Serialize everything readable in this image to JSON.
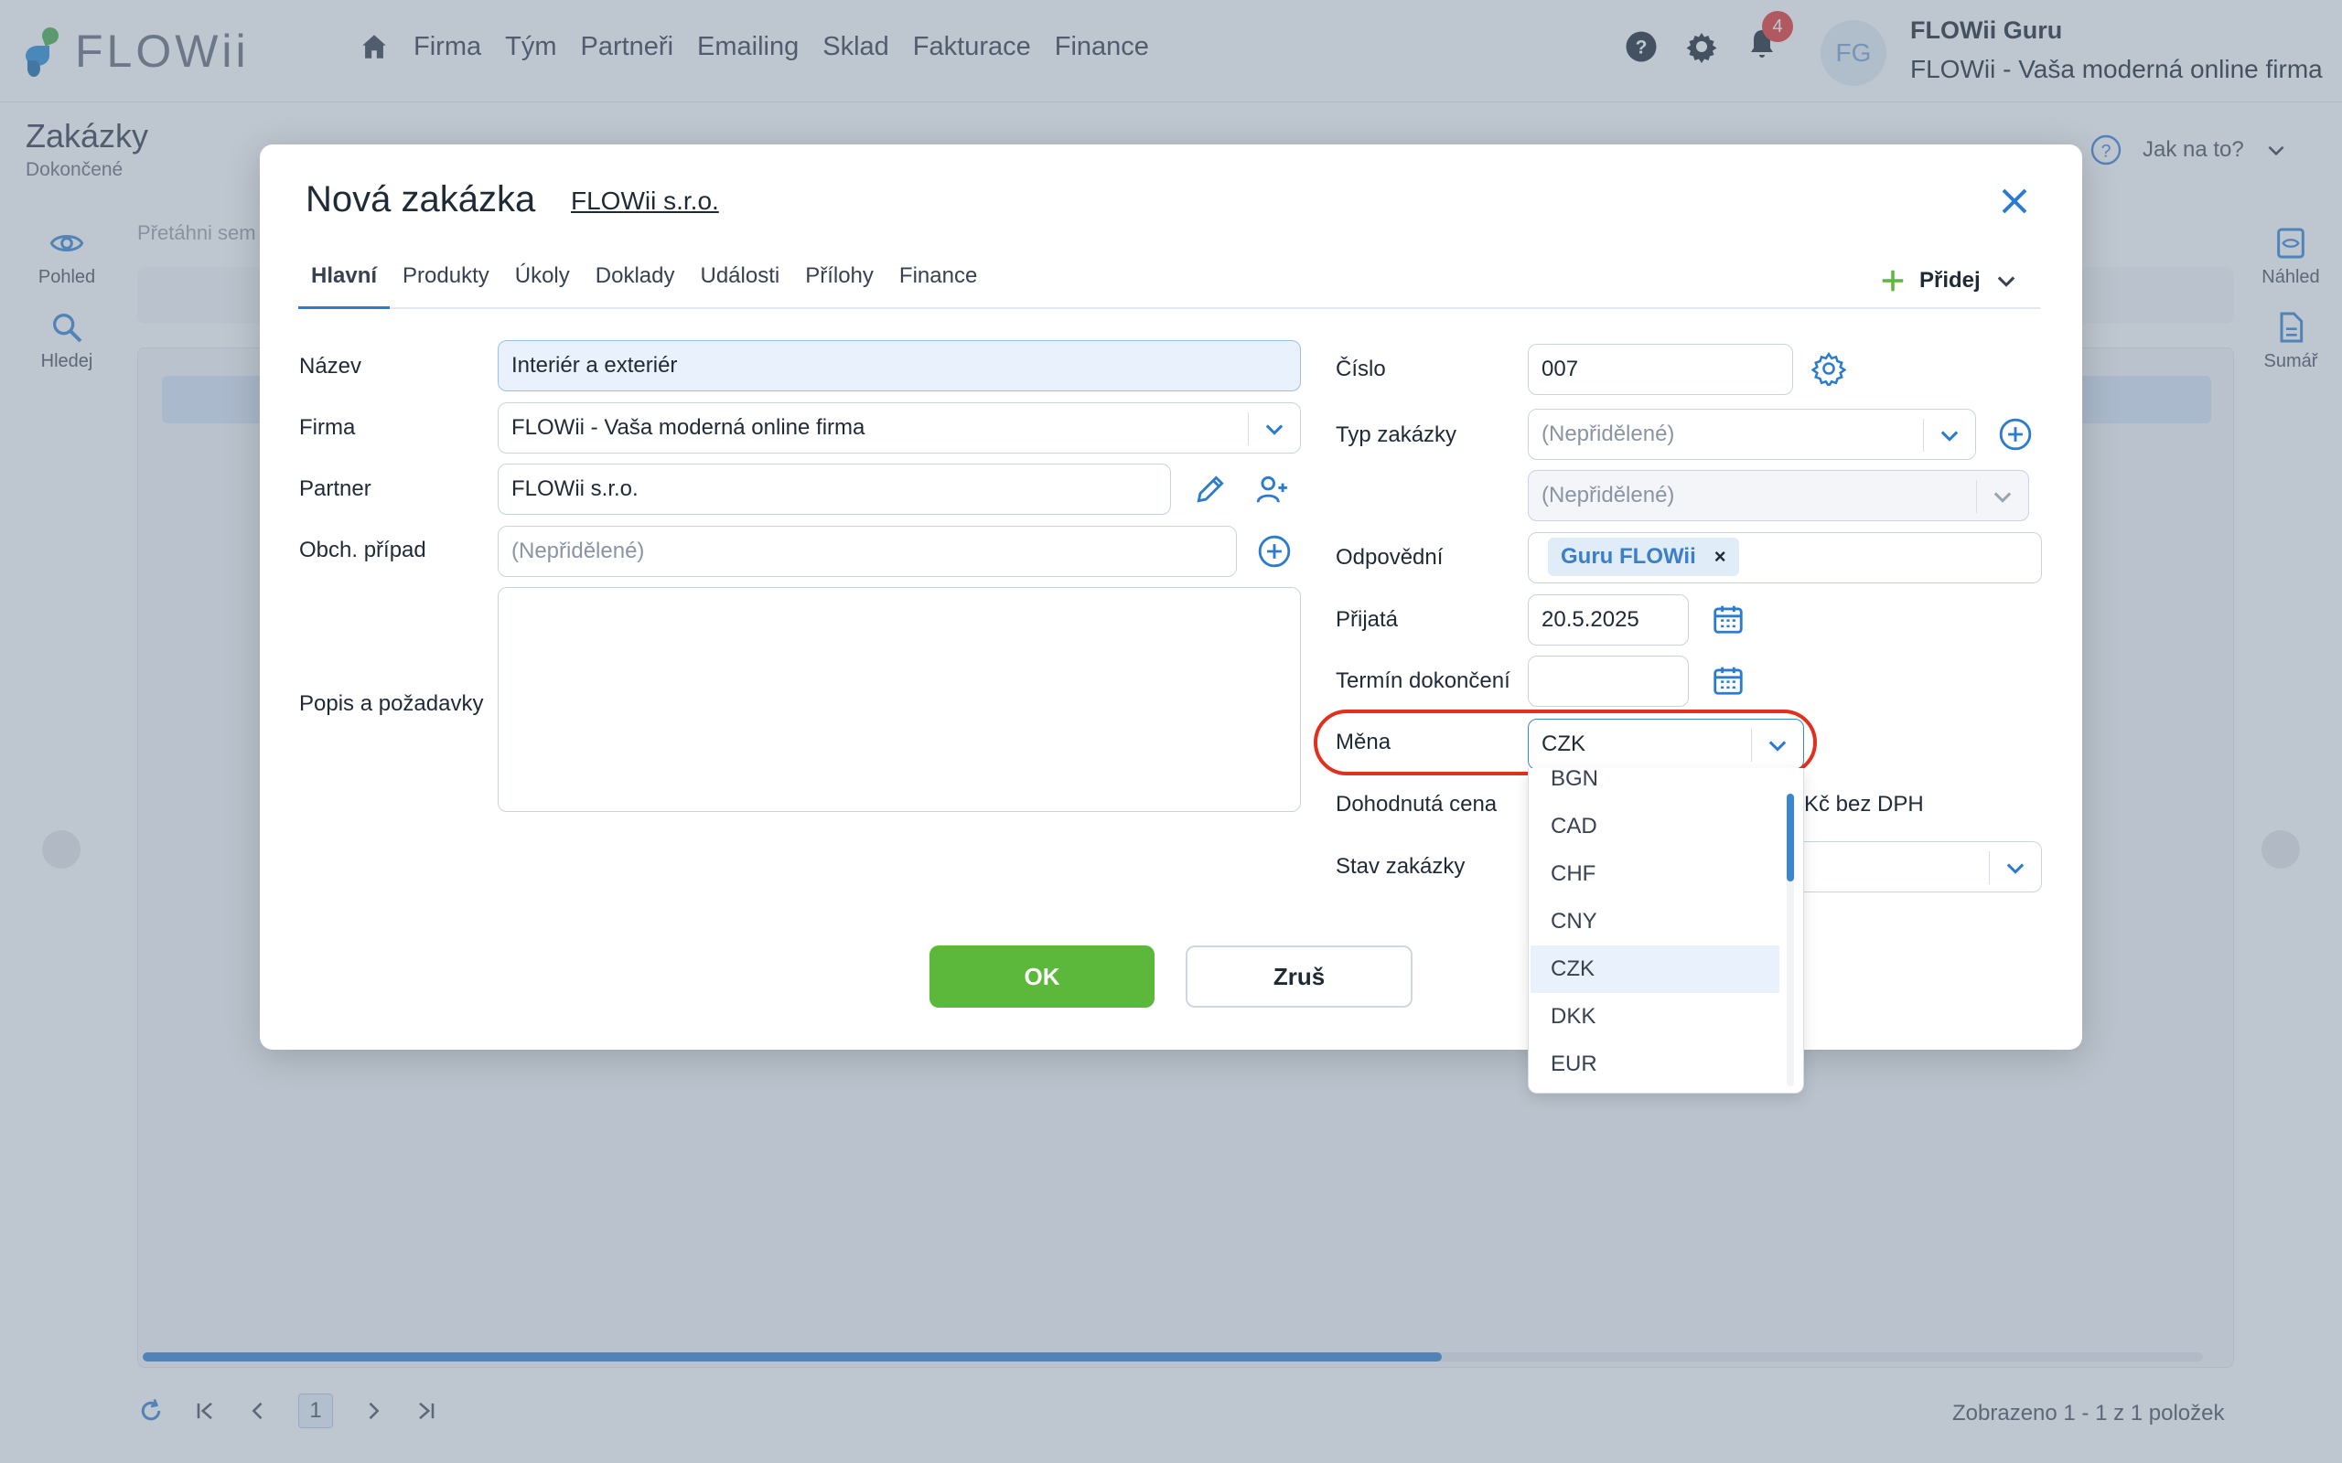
{
  "app": {
    "logo_text": "FLOWii",
    "nav": [
      "Firma",
      "Tým",
      "Partneři",
      "Emailing",
      "Sklad",
      "Fakturace",
      "Finance"
    ],
    "notification_count": "4",
    "avatar_initials": "FG",
    "user_name": "FLOWii Guru",
    "user_company": "FLOWii - Vaša moderná online firma"
  },
  "page": {
    "title": "Zakázky",
    "subtitle": "Dokončené",
    "help_label": "Jak na to?",
    "bg_hint": "Přetáhni sem",
    "sidebar_left": [
      "Pohled",
      "Hledej"
    ],
    "sidebar_right": [
      "Náhled",
      "Sumář"
    ],
    "pager_page": "1",
    "pager_status": "Zobrazeno 1 - 1 z 1 položek"
  },
  "modal": {
    "title": "Nová zakázka",
    "company_link": "FLOWii s.r.o.",
    "tabs": [
      "Hlavní",
      "Produkty",
      "Úkoly",
      "Doklady",
      "Události",
      "Přílohy",
      "Finance"
    ],
    "add_label": "Přidej",
    "left": {
      "nazev_label": "Název",
      "nazev_value": "Interiér a exteriér",
      "firma_label": "Firma",
      "firma_value": "FLOWii - Vaša moderná online firma",
      "partner_label": "Partner",
      "partner_value": "FLOWii s.r.o.",
      "obch_label": "Obch. případ",
      "obch_placeholder": "(Nepřidělené)",
      "popis_label": "Popis a požadavky"
    },
    "right": {
      "cislo_label": "Číslo",
      "cislo_value": "007",
      "typ_label": "Typ zakázky",
      "typ_value": "(Nepřidělené)",
      "typ_sub_value": "(Nepřidělené)",
      "odpovedni_label": "Odpovědní",
      "odpovedni_tag": "Guru FLOWii",
      "odpovedni_tag_remove": "×",
      "prijata_label": "Přijatá",
      "prijata_value": "20.5.2025",
      "termin_label": "Termín dokončení",
      "termin_value": "",
      "mena_label": "Měna",
      "mena_value": "CZK",
      "cena_label": "Dohodnutá cena",
      "cena_suffix": "Kč bez DPH",
      "stav_label": "Stav zakázky"
    },
    "currency_options": [
      "BGN",
      "CAD",
      "CHF",
      "CNY",
      "CZK",
      "DKK",
      "EUR"
    ],
    "currency_selected": "CZK",
    "ok_label": "OK",
    "cancel_label": "Zruš"
  },
  "colors": {
    "accent": "#2b7bd0",
    "ok_green": "#5cb83a",
    "highlight_ring": "#e0301e",
    "badge_red": "#e53935"
  }
}
